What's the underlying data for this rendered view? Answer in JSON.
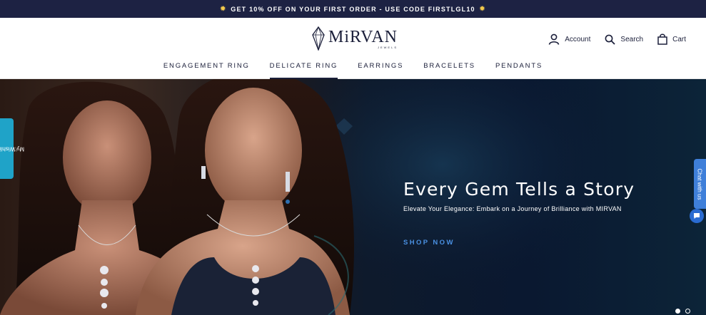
{
  "announcement": {
    "text": "GET 10% OFF ON YOUR FIRST ORDER - USE CODE FIRSTLGL10",
    "icon": "sparkle-icon",
    "icon_color": "#f2c94c",
    "bg_color": "#1d2243"
  },
  "header": {
    "logo_name": "MiRVAN",
    "logo_sub": "JEWELS",
    "account_label": "Account",
    "search_label": "Search",
    "cart_label": "Cart",
    "icons": [
      "user-icon",
      "search-icon",
      "shopping-bag-icon"
    ]
  },
  "nav": {
    "items": [
      {
        "label": "ENGAGEMENT RING",
        "active": false
      },
      {
        "label": "DELICATE RING",
        "active": true
      },
      {
        "label": "EARRINGS",
        "active": false
      },
      {
        "label": "BRACELETS",
        "active": false
      },
      {
        "label": "PENDANTS",
        "active": false
      }
    ]
  },
  "hero": {
    "title": "Every Gem Tells a Story",
    "subtitle": "Elevate Your Elegance: Embark on a Journey of Brilliance with MIRVAN",
    "cta": "SHOP NOW",
    "cta_color": "#4a90e2",
    "slides": 2,
    "active_slide": 1
  },
  "widgets": {
    "wishlist_label": "My Wishlist",
    "wishlist_color": "#1fa3c8",
    "chat_label": "Chat with us",
    "chat_color": "#3f7fd9"
  }
}
